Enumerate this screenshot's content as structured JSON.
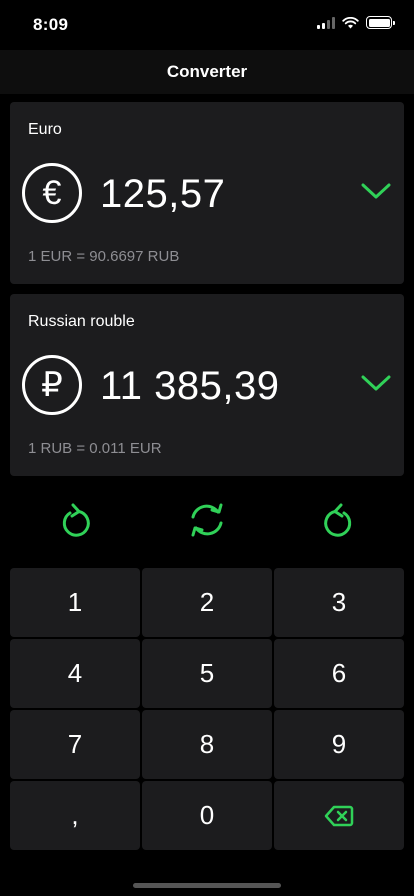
{
  "status_bar": {
    "time": "8:09"
  },
  "nav": {
    "title": "Converter"
  },
  "cards": [
    {
      "name": "Euro",
      "symbol": "€",
      "amount": "125,57",
      "rate": "1 EUR = 90.6697 RUB"
    },
    {
      "name": "Russian rouble",
      "symbol": "₽",
      "amount": "11 385,39",
      "rate": "1 RUB = 0.011 EUR"
    }
  ],
  "keypad": {
    "keys": [
      "1",
      "2",
      "3",
      "4",
      "5",
      "6",
      "7",
      "8",
      "9",
      ",",
      "0"
    ],
    "backspace_icon": "backspace-icon"
  },
  "colors": {
    "accent": "#30d158",
    "card": "#1c1c1e",
    "secondary_text": "#8e8e93"
  }
}
